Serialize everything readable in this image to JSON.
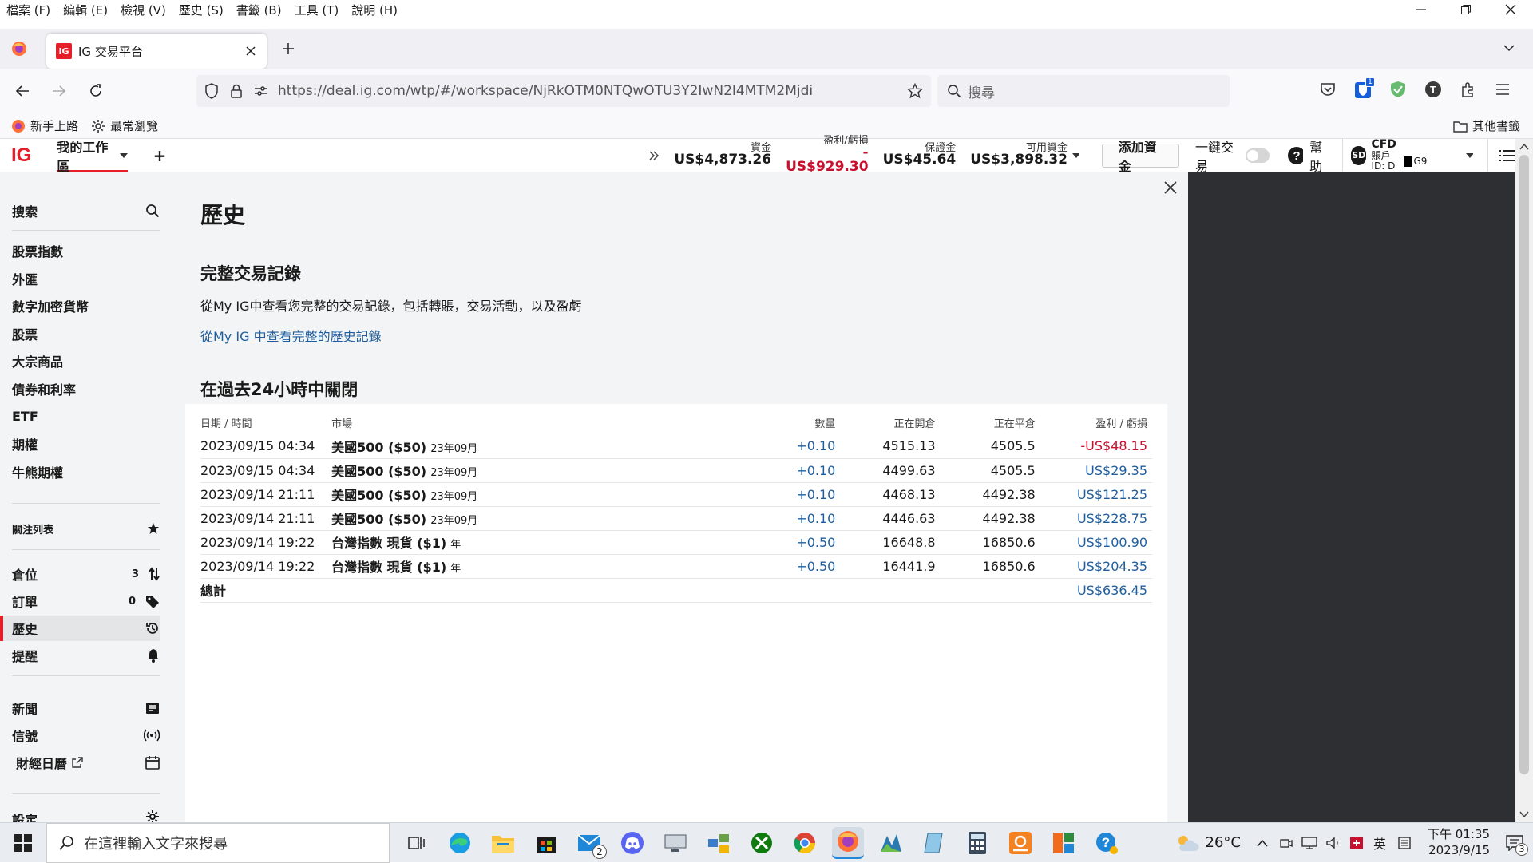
{
  "menu": [
    "檔案 (F)",
    "編輯 (E)",
    "檢視 (V)",
    "歷史 (S)",
    "書籤 (B)",
    "工具 (T)",
    "說明 (H)"
  ],
  "tab": {
    "logo": "IG",
    "title": "IG 交易平台"
  },
  "url": "https://deal.ig.com/wtp/#/workspace/NjRkOTM0NTQwOTU3Y2IwN2I4MTM2Mjdi",
  "search_placeholder": "搜尋",
  "bookmarks": [
    "新手上路",
    "最常瀏覽"
  ],
  "other_bookmarks": "其他書籤",
  "ig_header": {
    "logo": "IG",
    "workspace": "我的工作區",
    "add": "+",
    "stats": [
      {
        "label": "資金",
        "value": "US$4,873.26",
        "color": "#1a1a1a"
      },
      {
        "label": "盈利/虧損",
        "value": "-US$929.30",
        "color": "#c8102e"
      },
      {
        "label": "保證金",
        "value": "US$45.64",
        "color": "#1a1a1a"
      },
      {
        "label": "可用資金",
        "value": "US$3,898.32",
        "color": "#1a1a1a"
      }
    ],
    "add_funds": "添加資金",
    "one_click": "一鍵交易",
    "help": "幫助",
    "avatar": "SD",
    "account_type": "CFD",
    "account_id": "賬戶ID: D",
    "account_id_suffix": "G9"
  },
  "sidebar": {
    "search": "搜索",
    "markets": [
      "股票指數",
      "外匯",
      "數字加密貨幣",
      "股票",
      "大宗商品",
      "債券和利率",
      "ETF",
      "期權",
      "牛熊期權"
    ],
    "watchlist": "關注列表",
    "positions": {
      "label": "倉位",
      "count": "3"
    },
    "orders": {
      "label": "訂單",
      "count": "0"
    },
    "history": "歷史",
    "alerts": "提醒",
    "news": "新聞",
    "signals": "信號",
    "calendar": "財經日曆",
    "settings": "設定"
  },
  "main": {
    "title": "歷史",
    "section1_title": "完整交易記錄",
    "section1_desc": "從My IG中查看您完整的交易記錄，包括轉賬，交易活動，以及盈虧",
    "section1_link": "從My IG 中查看完整的歷史記錄",
    "section2_title": "在過去24小時中關閉"
  },
  "table": {
    "headers": {
      "date": "日期 / 時間",
      "market": "市場",
      "qty": "數量",
      "open": "正在開倉",
      "close": "正在平倉",
      "pl": "盈利 / 虧損"
    },
    "rows": [
      {
        "date": "2023/09/15 04:34",
        "market": "美國500 ($50)",
        "expiry": "23年09月",
        "qty": "+0.10",
        "open": "4515.13",
        "close": "4505.5",
        "pl": "-US$48.15",
        "neg": true
      },
      {
        "date": "2023/09/15 04:34",
        "market": "美國500 ($50)",
        "expiry": "23年09月",
        "qty": "+0.10",
        "open": "4499.63",
        "close": "4505.5",
        "pl": "US$29.35",
        "neg": false
      },
      {
        "date": "2023/09/14 21:11",
        "market": "美國500 ($50)",
        "expiry": "23年09月",
        "qty": "+0.10",
        "open": "4468.13",
        "close": "4492.38",
        "pl": "US$121.25",
        "neg": false
      },
      {
        "date": "2023/09/14 21:11",
        "market": "美國500 ($50)",
        "expiry": "23年09月",
        "qty": "+0.10",
        "open": "4446.63",
        "close": "4492.38",
        "pl": "US$228.75",
        "neg": false
      },
      {
        "date": "2023/09/14 19:22",
        "market": "台灣指數 現貨 ($1)",
        "expiry": "年",
        "qty": "+0.50",
        "open": "16648.8",
        "close": "16850.6",
        "pl": "US$100.90",
        "neg": false
      },
      {
        "date": "2023/09/14 19:22",
        "market": "台灣指數 現貨 ($1)",
        "expiry": "年",
        "qty": "+0.50",
        "open": "16441.9",
        "close": "16850.6",
        "pl": "US$204.35",
        "neg": false
      }
    ],
    "total_label": "總計",
    "total_value": "US$636.45"
  },
  "taskbar": {
    "search_placeholder": "在這裡輸入文字來搜尋",
    "mail_badge": "2",
    "temperature": "26°C",
    "ime": "英",
    "time": "下午 01:35",
    "date": "2023/9/15",
    "notification_count": "3"
  }
}
